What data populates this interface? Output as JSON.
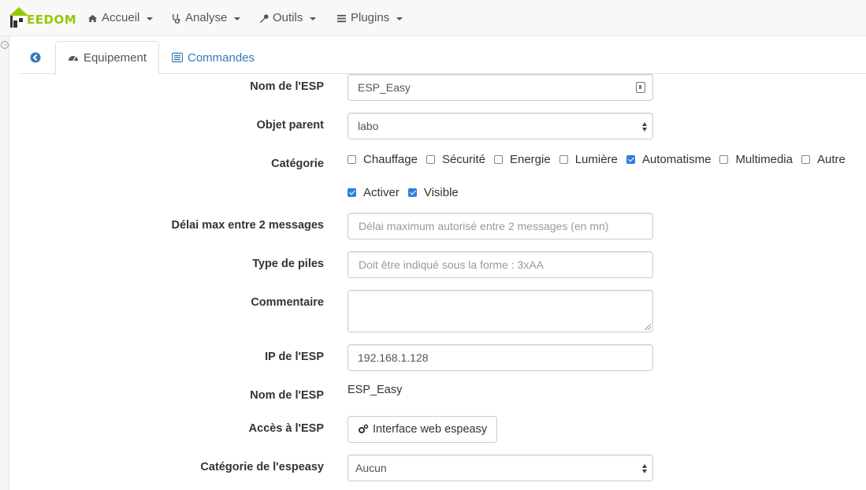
{
  "brand": {
    "word": "EEDOM"
  },
  "nav": [
    {
      "label": "Accueil",
      "icon": "home-icon"
    },
    {
      "label": "Analyse",
      "icon": "stethoscope-icon"
    },
    {
      "label": "Outils",
      "icon": "wrench-icon"
    },
    {
      "label": "Plugins",
      "icon": "list-icon"
    }
  ],
  "tabs": {
    "back_icon": "arrow-circle-left-icon",
    "equipement": "Equipement",
    "commandes": "Commandes"
  },
  "form": {
    "nom_label": "Nom de l'ESP",
    "nom_value": "ESP_Easy",
    "objet_label": "Objet parent",
    "objet_value": "labo",
    "categorie_label": "Catégorie",
    "categories": [
      {
        "label": "Chauffage",
        "checked": false
      },
      {
        "label": "Sécurité",
        "checked": false
      },
      {
        "label": "Energie",
        "checked": false
      },
      {
        "label": "Lumière",
        "checked": false
      },
      {
        "label": "Automatisme",
        "checked": true
      },
      {
        "label": "Multimedia",
        "checked": false
      },
      {
        "label": "Autre",
        "checked": false
      }
    ],
    "activer_label": "Activer",
    "visible_label": "Visible",
    "delai_label": "Délai max entre 2 messages",
    "delai_placeholder": "Délai maximum autorisé entre 2 messages (en mn)",
    "piles_label": "Type de piles",
    "piles_placeholder": "Doit être indiqué sous la forme : 3xAA",
    "commentaire_label": "Commentaire",
    "ip_label": "IP de l'ESP",
    "ip_value": "192.168.1.128",
    "nom2_label": "Nom de l'ESP",
    "nom2_value": "ESP_Easy",
    "acces_label": "Accès à l'ESP",
    "acces_button": "Interface web espeasy",
    "catesp_label": "Catégorie de l'espeasy",
    "catesp_value": "Aucun"
  }
}
